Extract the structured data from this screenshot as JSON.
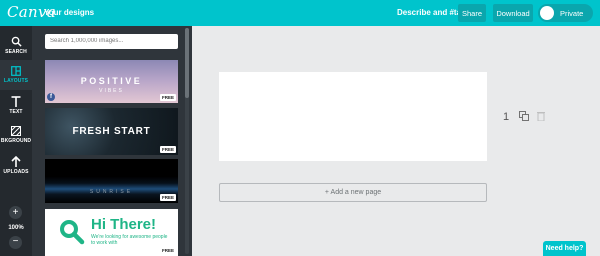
{
  "header": {
    "logo_text": "Canva",
    "your_designs": "Your designs",
    "describe": "Describe and #tag",
    "share": "Share",
    "download": "Download",
    "private": "Private"
  },
  "rail": {
    "search": "SEARCH",
    "layouts": "LAYOUTS",
    "text": "TEXT",
    "background": "BKGROUND",
    "uploads": "UPLOADS",
    "zoom_in": "+",
    "zoom": "100%",
    "zoom_out": "−"
  },
  "panel": {
    "search_placeholder": "Search 1,000,000 images...",
    "cards": [
      {
        "title": "POSITIVE",
        "subtitle": "VIBES",
        "badge": "FREE",
        "social": "f"
      },
      {
        "title": "FRESH START",
        "badge": "FREE"
      },
      {
        "title": "SUNRISE",
        "badge": "FREE"
      },
      {
        "title": "Hi There!",
        "subtitle": "We're looking for awesome people to work with",
        "badge": "FREE"
      }
    ]
  },
  "canvas": {
    "page_number": "1",
    "add_page": "+ Add a new page"
  },
  "help": "Need help?",
  "colors": {
    "accent": "#00c4cc",
    "rail_bg": "#24292e",
    "panel_bg": "#2f353b",
    "canvas_bg": "#e9eaeb",
    "hi_there_green": "#1fb587"
  }
}
